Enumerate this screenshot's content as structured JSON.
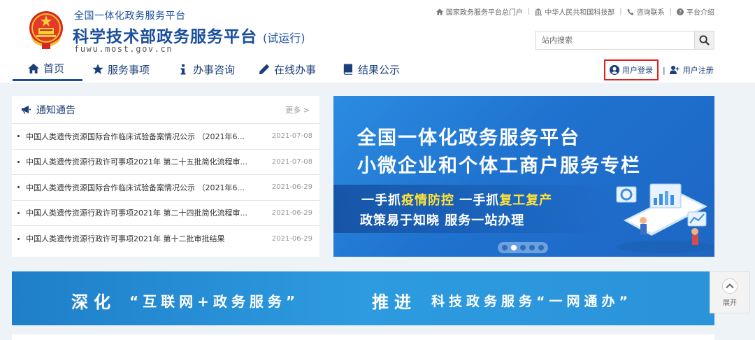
{
  "header": {
    "subtitle": "全国一体化政务服务平台",
    "title": "科学技术部政务服务平台",
    "trial": "(试运行)",
    "url": "fuwu.most.gov.cn"
  },
  "top_links": [
    {
      "label": "国家政务服务平台总门户",
      "icon": "home-icon"
    },
    {
      "label": "中华人民共和国科技部",
      "icon": "bank-icon"
    },
    {
      "label": "咨询联系",
      "icon": "phone-icon"
    },
    {
      "label": "平台介绍",
      "icon": "help-icon"
    }
  ],
  "search": {
    "placeholder": "站内搜索"
  },
  "nav": [
    {
      "label": "首页",
      "icon": "home-icon",
      "active": true
    },
    {
      "label": "服务事项",
      "icon": "star-icon"
    },
    {
      "label": "办事咨询",
      "icon": "info-icon"
    },
    {
      "label": "在线办事",
      "icon": "pencil-icon"
    },
    {
      "label": "结果公示",
      "icon": "book-icon"
    }
  ],
  "auth": {
    "login": "用户登录",
    "separator": "|",
    "register": "用户注册"
  },
  "notice": {
    "title": "通知通告",
    "more": "更多 >",
    "items": [
      {
        "text": "中国人类遗传资源国际合作临床试验备案情况公示 （2021年6...",
        "date": "2021-07-08"
      },
      {
        "text": "中国人类遗传资源行政许可事项2021年 第二十五批简化流程审...",
        "date": "2021-07-08"
      },
      {
        "text": "中国人类遗传资源国际合作临床试验备案情况公示 （2021年6...",
        "date": "2021-06-29"
      },
      {
        "text": "中国人类遗传资源行政许可事项2021年 第二十四批简化流程审...",
        "date": "2021-06-29"
      },
      {
        "text": "中国人类遗传资源行政许可事项2021年 第十二批审批结果",
        "date": "2021-06-29"
      }
    ]
  },
  "banner": {
    "line1": "全国一体化政务服务平台",
    "line2": "小微企业和个体工商户服务专栏",
    "line3_a": "一手抓",
    "line3_b": "疫情防控",
    "line3_c": " 一手抓",
    "line3_d": "复工复产",
    "line4": "政策易于知晓 服务一站办理",
    "active_slide": 2,
    "slide_count": 5
  },
  "slogan": {
    "a": "深化",
    "b": "“互联网+政务服务”",
    "c": "推进",
    "d": "科技政务服务“一网通办”"
  },
  "expand": {
    "label": "展开"
  },
  "colors": {
    "brand": "#1a4f9c",
    "login_highlight": "#e02020",
    "banner": "#1f72cf",
    "highlight_text": "#ffe23a"
  }
}
